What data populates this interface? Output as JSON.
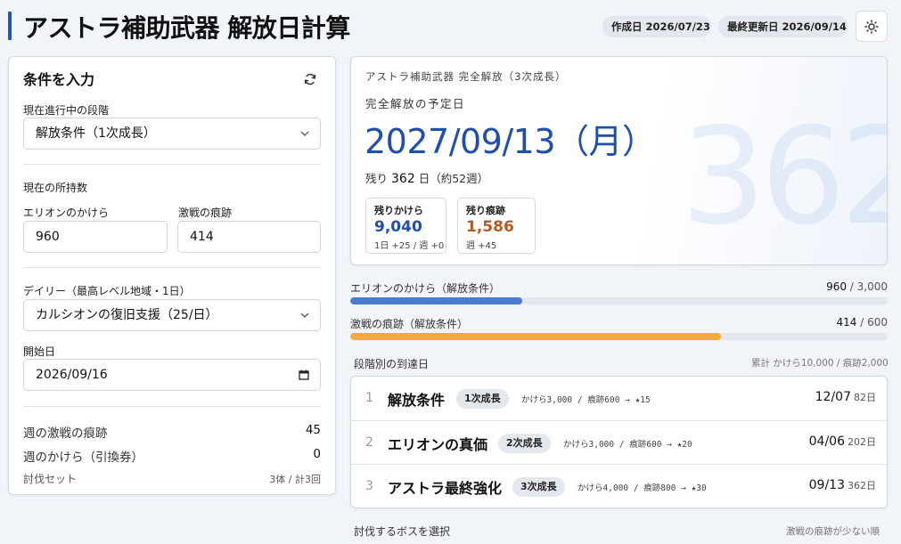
{
  "header": {
    "title": "アストラ補助武器 解放日計算",
    "created": "作成日 2026/07/23",
    "updated": "最終更新日 2026/09/14"
  },
  "inputs": {
    "title": "条件を入力",
    "stage_label": "現在進行中の段階",
    "stage_value": "解放条件（1次成長）",
    "holdings_label": "現在の所持数",
    "erion_label": "エリオンのかけら",
    "erion_value": "960",
    "trace_label": "激戦の痕跡",
    "trace_value": "414",
    "daily_label": "デイリー（最高レベル地域・1日）",
    "daily_value": "カルシオンの復旧支援（25/日）",
    "start_label": "開始日",
    "start_value": "2026/09/16",
    "weekly_trace_label": "週の激戦の痕跡",
    "weekly_trace_value": "45",
    "weekly_shard_label": "週のかけら（引換券）",
    "weekly_shard_value": "0",
    "boss_set_label": "討伐セット",
    "boss_set_value": "3体 / 計3回"
  },
  "result": {
    "subtitle": "アストラ補助武器 完全解放（3次成長）",
    "date_label": "完全解放の予定日",
    "date": "2027/09/13（月）",
    "remain_prefix": "残り",
    "remain_days": "362",
    "remain_suffix": "日（約52週）",
    "big_number": "362",
    "shard_label": "残りかけら",
    "shard_value": "9,040",
    "shard_rate": "1日 +25 / 週 +0",
    "trace_label": "残り痕跡",
    "trace_value": "1,586",
    "trace_rate": "週 +45",
    "colors": {
      "accent": "#1f4fae",
      "trace": "#b85a1e"
    }
  },
  "progress": {
    "erion": {
      "label": "エリオンのかけら（解放条件）",
      "current": "960",
      "total": "3,000",
      "fraction": 0.32,
      "color": "#4a7bd0"
    },
    "trace": {
      "label": "激戦の痕跡（解放条件）",
      "current": "414",
      "total": "600",
      "fraction": 0.69,
      "color": "#f2aa3d"
    }
  },
  "stages": {
    "title": "段階別の到達日",
    "summary": "累計 かけら10,000 / 痕跡2,000",
    "items": [
      {
        "num": "1",
        "name": "解放条件",
        "badge": "1次成長",
        "req": "かけら3,000 / 痕跡600 → ★15",
        "date": "12/07",
        "days": "82日"
      },
      {
        "num": "2",
        "name": "エリオンの真価",
        "badge": "2次成長",
        "req": "かけら3,000 / 痕跡600 → ★20",
        "date": "04/06",
        "days": "202日"
      },
      {
        "num": "3",
        "name": "アストラ最終強化",
        "badge": "3次成長",
        "req": "かけら4,000 / 痕跡800 → ★30",
        "date": "09/13",
        "days": "362日"
      }
    ]
  },
  "boss": {
    "title": "討伐するボスを選択",
    "sort": "激戦の痕跡が少ない順"
  }
}
